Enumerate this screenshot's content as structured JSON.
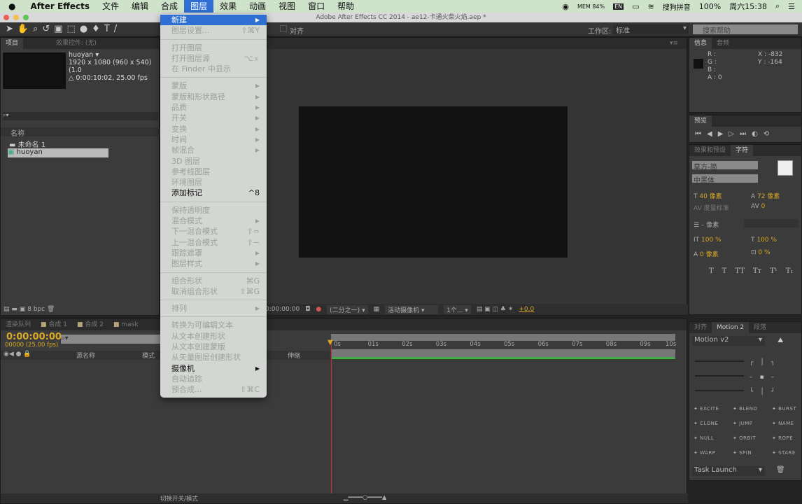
{
  "menubar": {
    "apple": "",
    "app": "After Effects",
    "items": [
      "文件",
      "编辑",
      "合成",
      "图层",
      "效果",
      "动画",
      "视图",
      "窗口",
      "帮助"
    ],
    "active": "图层",
    "status": {
      "mem": "MEM 84%",
      "input_lang": "EN",
      "ime": "搜狗拼音",
      "battery": "100%",
      "clock": "周六15:38"
    }
  },
  "window": {
    "title": "Adobe After Effects CC 2014 - ae12-卡通火柴火焰.aep *"
  },
  "toolbar": {
    "align_label": "对齐",
    "workspace_label": "工作区:",
    "workspace_value": "标准",
    "search_placeholder": "搜索帮助"
  },
  "project": {
    "tabs": [
      "项目",
      "效果控件: (无)"
    ],
    "comp_name": "huoyan ▾",
    "comp_size": "1920 x 1080  (960 x 540) (1.0",
    "comp_duration": "△ 0:00:10:02, 25.00 fps",
    "search_placeholder": "⌕▾",
    "column_name": "名称",
    "items": [
      {
        "name": "未命名 1",
        "type": "folder"
      },
      {
        "name": "huoyan",
        "type": "comp"
      }
    ],
    "bpc": "8 bpc"
  },
  "viewer": {
    "timecode": "0:00:00:00",
    "resolution": "(二分之一)",
    "camera": "活动摄像机",
    "views": "1个...",
    "exposure": "+0.0"
  },
  "layer_menu": {
    "items": [
      {
        "label": "新建",
        "submenu": true,
        "enabled": true,
        "highlight": true
      },
      {
        "label": "图层设置...",
        "shortcut": "⇧⌘Y"
      },
      {
        "sep": true
      },
      {
        "label": "打开图层"
      },
      {
        "label": "打开图层源",
        "shortcut": "⌥⌅"
      },
      {
        "label": "在 Finder 中显示"
      },
      {
        "sep": true
      },
      {
        "label": "蒙版",
        "submenu": true
      },
      {
        "label": "蒙版和形状路径",
        "submenu": true
      },
      {
        "label": "品质",
        "submenu": true
      },
      {
        "label": "开关",
        "submenu": true
      },
      {
        "label": "变换",
        "submenu": true
      },
      {
        "label": "时间",
        "submenu": true
      },
      {
        "label": "帧混合",
        "submenu": true
      },
      {
        "label": "3D 图层"
      },
      {
        "label": "参考线图层"
      },
      {
        "label": "环境图层"
      },
      {
        "label": "添加标记",
        "shortcut": "^8",
        "enabled": true
      },
      {
        "sep": true
      },
      {
        "label": "保持透明度"
      },
      {
        "label": "混合模式",
        "submenu": true
      },
      {
        "label": "下一混合模式",
        "shortcut": "⇧="
      },
      {
        "label": "上一混合模式",
        "shortcut": "⇧−"
      },
      {
        "label": "跟踪遮罩",
        "submenu": true
      },
      {
        "label": "图层样式",
        "submenu": true
      },
      {
        "sep": true
      },
      {
        "label": "组合形状",
        "shortcut": "⌘G"
      },
      {
        "label": "取消组合形状",
        "shortcut": "⇧⌘G"
      },
      {
        "sep": true
      },
      {
        "label": "排列",
        "submenu": true
      },
      {
        "sep": true
      },
      {
        "label": "转换为可编辑文本"
      },
      {
        "label": "从文本创建形状"
      },
      {
        "label": "从文本创建蒙版"
      },
      {
        "label": "从矢量图层创建形状"
      },
      {
        "label": "摄像机",
        "submenu": true,
        "enabled": true
      },
      {
        "label": "自动追踪"
      },
      {
        "label": "预合成...",
        "shortcut": "⇧⌘C"
      }
    ]
  },
  "info": {
    "tabs": [
      "信息",
      "音频"
    ],
    "r": "R :",
    "g": "G :",
    "b": "B :",
    "a": "A : 0",
    "x": "X : -832",
    "y": "Y : -164"
  },
  "preview": {
    "tab": "预览"
  },
  "character": {
    "tabs": [
      "效果和预设",
      "字符"
    ],
    "font": "草方-简",
    "style": "中黑体",
    "size": "40 像素",
    "leading": "72 像素",
    "kerning": "度量标准",
    "tracking": "0",
    "stroke": "– 像素",
    "vscale": "100 %",
    "hscale": "100 %",
    "baseline": "0 像素",
    "tsume": "0 %",
    "styles": [
      "T",
      "T",
      "TT",
      "Tт",
      "T¹",
      "T₁"
    ]
  },
  "timeline": {
    "tabs": [
      "渲染队列",
      "合成 1",
      "合成 2",
      "mask"
    ],
    "timecode": "0:00:00:00",
    "frames": "00000 (25.00 fps)",
    "columns": [
      "源名称",
      "模式",
      "伸缩"
    ],
    "ruler": [
      "0s",
      "01s",
      "02s",
      "03s",
      "04s",
      "05s",
      "06s",
      "07s",
      "08s",
      "09s",
      "10s"
    ],
    "footer": "切换开关/模式"
  },
  "motion": {
    "tabs": [
      "对齐",
      "Motion 2",
      "段落"
    ],
    "preset": "Motion v2",
    "buttons": [
      "EXCITE",
      "BLEND",
      "BURST",
      "CLONE",
      "JUMP",
      "NAME",
      "NULL",
      "ORBIT",
      "ROPE",
      "WARP",
      "SPIN",
      "STARE"
    ],
    "task": "Task Launch"
  },
  "colors": {
    "accent": "#2f6fd3",
    "timecode": "#d8a826",
    "work_area": "#3fb33f",
    "playhead": "#c8303a"
  }
}
